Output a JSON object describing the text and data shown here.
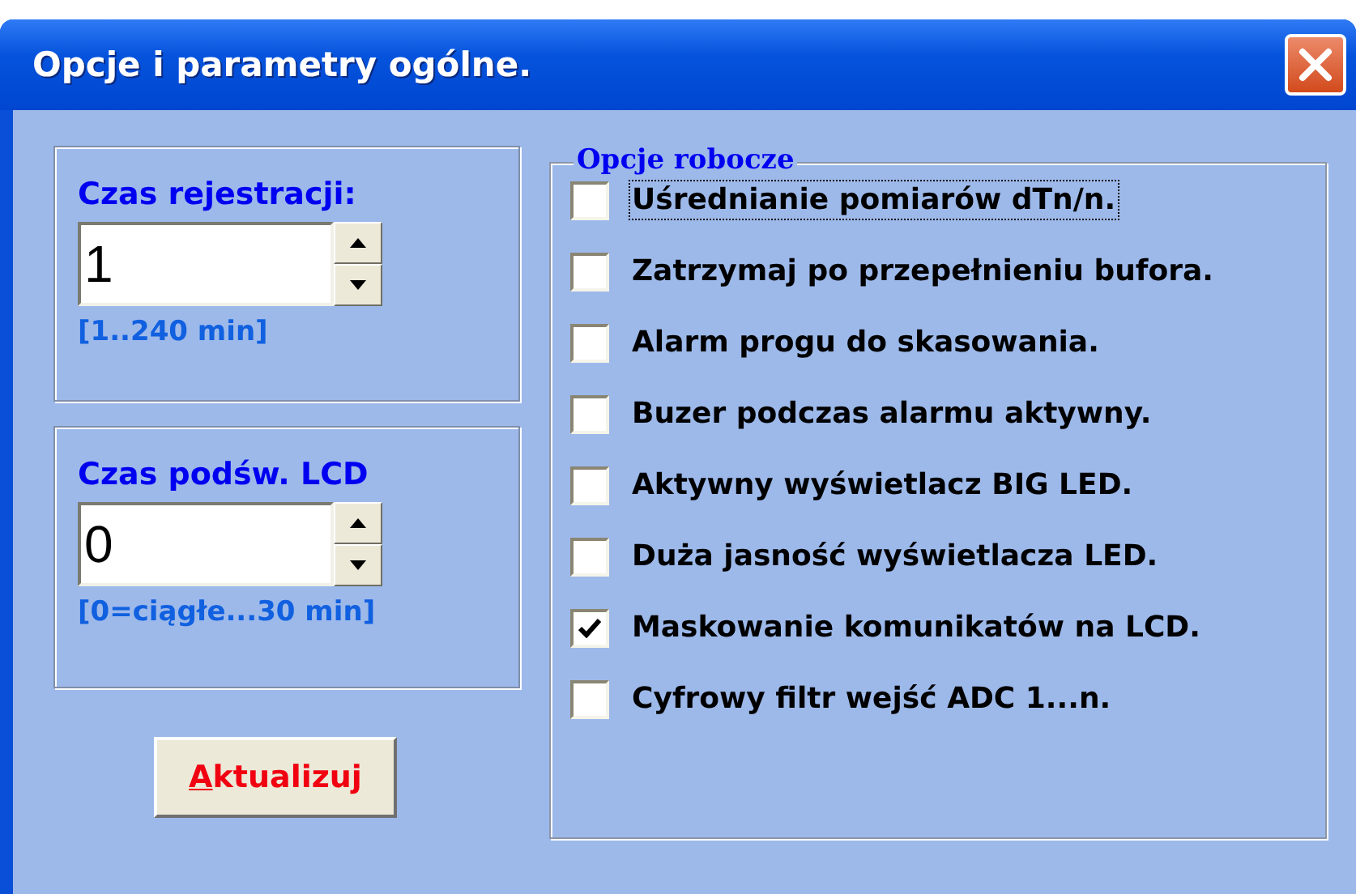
{
  "window": {
    "title": "Opcje i parametry ogólne."
  },
  "spinners": [
    {
      "label": "Czas rejestracji:",
      "value": "1",
      "range": "[1..240 min]"
    },
    {
      "label": "Czas podśw. LCD",
      "value": "0",
      "range": "[0=ciągłe...30 min]"
    }
  ],
  "update_button": {
    "label": "Aktualizuj",
    "first_letter_underlined": true
  },
  "options_group": {
    "title": "Opcje robocze",
    "options": [
      {
        "label": "Uśrednianie pomiarów dTn/n.",
        "checked": false,
        "focused": true
      },
      {
        "label": "Zatrzymaj po przepełnieniu bufora.",
        "checked": false,
        "focused": false
      },
      {
        "label": "Alarm progu do skasowania.",
        "checked": false,
        "focused": false
      },
      {
        "label": "Buzer podczas alarmu aktywny.",
        "checked": false,
        "focused": false
      },
      {
        "label": "Aktywny wyświetlacz BIG LED.",
        "checked": false,
        "focused": false
      },
      {
        "label": "Duża jasność wyświetlacza LED.",
        "checked": false,
        "focused": false
      },
      {
        "label": "Maskowanie komunikatów na LCD.",
        "checked": true,
        "focused": false
      },
      {
        "label": "Cyfrowy filtr wejść ADC 1...n.",
        "checked": false,
        "focused": false
      }
    ]
  }
}
